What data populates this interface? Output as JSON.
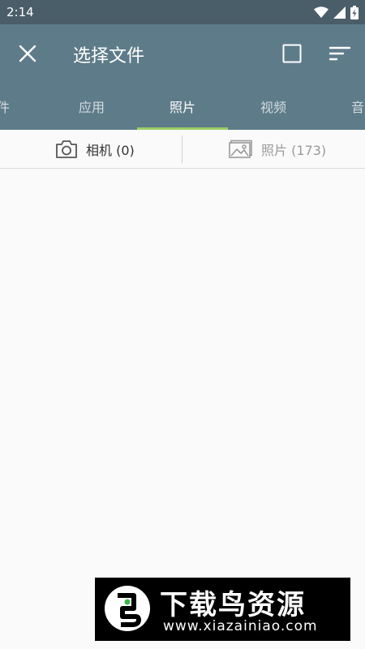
{
  "status_bar": {
    "time": "2:14",
    "icons": [
      "wifi-icon",
      "signal-icon",
      "battery-charging-icon"
    ]
  },
  "app_bar": {
    "title": "选择文件",
    "icons": {
      "close": "close-icon",
      "select_all": "checkbox-outline-icon",
      "sort": "sort-icon"
    }
  },
  "tabs": [
    {
      "label": "件"
    },
    {
      "label": "应用"
    },
    {
      "label": "照片",
      "active": true
    },
    {
      "label": "视频"
    },
    {
      "label": "音"
    }
  ],
  "sub_tabs": {
    "camera": {
      "label": "相机 (0)",
      "icon": "camera-icon"
    },
    "photos": {
      "label": "照片 (173)",
      "icon": "image-icon"
    }
  },
  "watermark": {
    "name": "下载鸟资源",
    "url": "www.xiazainiao.com"
  },
  "colors": {
    "status_bar": "#4a5e6a",
    "app_bar": "#5d7b89",
    "tab_indicator": "#9ccc65",
    "background": "#fafafa"
  }
}
